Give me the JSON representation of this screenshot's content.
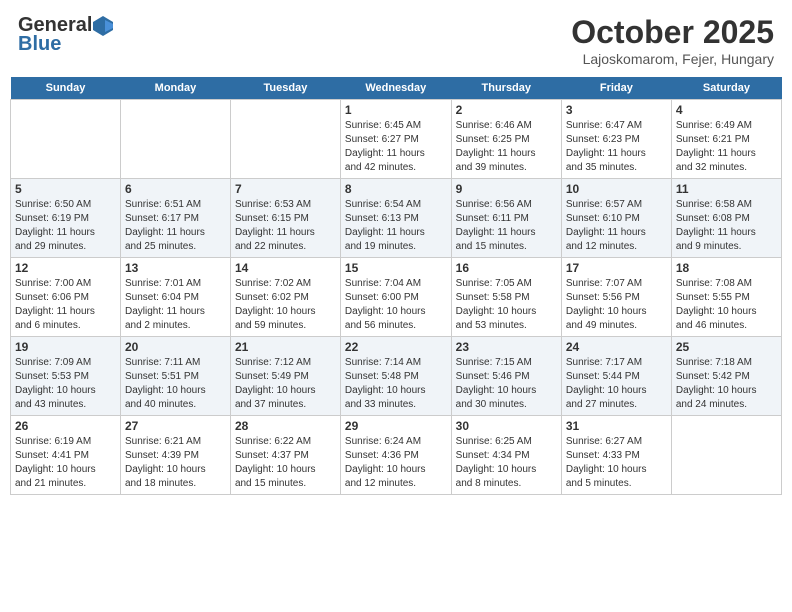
{
  "header": {
    "logo_general": "General",
    "logo_blue": "Blue",
    "month": "October 2025",
    "location": "Lajoskomarom, Fejer, Hungary"
  },
  "days_of_week": [
    "Sunday",
    "Monday",
    "Tuesday",
    "Wednesday",
    "Thursday",
    "Friday",
    "Saturday"
  ],
  "weeks": [
    [
      {
        "day": "",
        "info": ""
      },
      {
        "day": "",
        "info": ""
      },
      {
        "day": "",
        "info": ""
      },
      {
        "day": "1",
        "info": "Sunrise: 6:45 AM\nSunset: 6:27 PM\nDaylight: 11 hours\nand 42 minutes."
      },
      {
        "day": "2",
        "info": "Sunrise: 6:46 AM\nSunset: 6:25 PM\nDaylight: 11 hours\nand 39 minutes."
      },
      {
        "day": "3",
        "info": "Sunrise: 6:47 AM\nSunset: 6:23 PM\nDaylight: 11 hours\nand 35 minutes."
      },
      {
        "day": "4",
        "info": "Sunrise: 6:49 AM\nSunset: 6:21 PM\nDaylight: 11 hours\nand 32 minutes."
      }
    ],
    [
      {
        "day": "5",
        "info": "Sunrise: 6:50 AM\nSunset: 6:19 PM\nDaylight: 11 hours\nand 29 minutes."
      },
      {
        "day": "6",
        "info": "Sunrise: 6:51 AM\nSunset: 6:17 PM\nDaylight: 11 hours\nand 25 minutes."
      },
      {
        "day": "7",
        "info": "Sunrise: 6:53 AM\nSunset: 6:15 PM\nDaylight: 11 hours\nand 22 minutes."
      },
      {
        "day": "8",
        "info": "Sunrise: 6:54 AM\nSunset: 6:13 PM\nDaylight: 11 hours\nand 19 minutes."
      },
      {
        "day": "9",
        "info": "Sunrise: 6:56 AM\nSunset: 6:11 PM\nDaylight: 11 hours\nand 15 minutes."
      },
      {
        "day": "10",
        "info": "Sunrise: 6:57 AM\nSunset: 6:10 PM\nDaylight: 11 hours\nand 12 minutes."
      },
      {
        "day": "11",
        "info": "Sunrise: 6:58 AM\nSunset: 6:08 PM\nDaylight: 11 hours\nand 9 minutes."
      }
    ],
    [
      {
        "day": "12",
        "info": "Sunrise: 7:00 AM\nSunset: 6:06 PM\nDaylight: 11 hours\nand 6 minutes."
      },
      {
        "day": "13",
        "info": "Sunrise: 7:01 AM\nSunset: 6:04 PM\nDaylight: 11 hours\nand 2 minutes."
      },
      {
        "day": "14",
        "info": "Sunrise: 7:02 AM\nSunset: 6:02 PM\nDaylight: 10 hours\nand 59 minutes."
      },
      {
        "day": "15",
        "info": "Sunrise: 7:04 AM\nSunset: 6:00 PM\nDaylight: 10 hours\nand 56 minutes."
      },
      {
        "day": "16",
        "info": "Sunrise: 7:05 AM\nSunset: 5:58 PM\nDaylight: 10 hours\nand 53 minutes."
      },
      {
        "day": "17",
        "info": "Sunrise: 7:07 AM\nSunset: 5:56 PM\nDaylight: 10 hours\nand 49 minutes."
      },
      {
        "day": "18",
        "info": "Sunrise: 7:08 AM\nSunset: 5:55 PM\nDaylight: 10 hours\nand 46 minutes."
      }
    ],
    [
      {
        "day": "19",
        "info": "Sunrise: 7:09 AM\nSunset: 5:53 PM\nDaylight: 10 hours\nand 43 minutes."
      },
      {
        "day": "20",
        "info": "Sunrise: 7:11 AM\nSunset: 5:51 PM\nDaylight: 10 hours\nand 40 minutes."
      },
      {
        "day": "21",
        "info": "Sunrise: 7:12 AM\nSunset: 5:49 PM\nDaylight: 10 hours\nand 37 minutes."
      },
      {
        "day": "22",
        "info": "Sunrise: 7:14 AM\nSunset: 5:48 PM\nDaylight: 10 hours\nand 33 minutes."
      },
      {
        "day": "23",
        "info": "Sunrise: 7:15 AM\nSunset: 5:46 PM\nDaylight: 10 hours\nand 30 minutes."
      },
      {
        "day": "24",
        "info": "Sunrise: 7:17 AM\nSunset: 5:44 PM\nDaylight: 10 hours\nand 27 minutes."
      },
      {
        "day": "25",
        "info": "Sunrise: 7:18 AM\nSunset: 5:42 PM\nDaylight: 10 hours\nand 24 minutes."
      }
    ],
    [
      {
        "day": "26",
        "info": "Sunrise: 6:19 AM\nSunset: 4:41 PM\nDaylight: 10 hours\nand 21 minutes."
      },
      {
        "day": "27",
        "info": "Sunrise: 6:21 AM\nSunset: 4:39 PM\nDaylight: 10 hours\nand 18 minutes."
      },
      {
        "day": "28",
        "info": "Sunrise: 6:22 AM\nSunset: 4:37 PM\nDaylight: 10 hours\nand 15 minutes."
      },
      {
        "day": "29",
        "info": "Sunrise: 6:24 AM\nSunset: 4:36 PM\nDaylight: 10 hours\nand 12 minutes."
      },
      {
        "day": "30",
        "info": "Sunrise: 6:25 AM\nSunset: 4:34 PM\nDaylight: 10 hours\nand 8 minutes."
      },
      {
        "day": "31",
        "info": "Sunrise: 6:27 AM\nSunset: 4:33 PM\nDaylight: 10 hours\nand 5 minutes."
      },
      {
        "day": "",
        "info": ""
      }
    ]
  ]
}
